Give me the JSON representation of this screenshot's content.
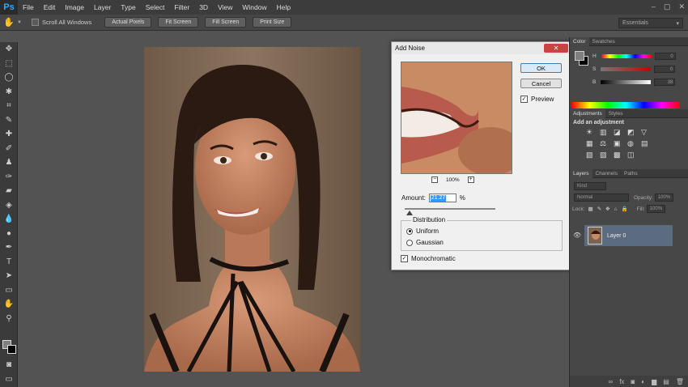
{
  "app": {
    "logo": "Ps"
  },
  "menu": [
    "File",
    "Edit",
    "Image",
    "Layer",
    "Type",
    "Select",
    "Filter",
    "3D",
    "View",
    "Window",
    "Help"
  ],
  "window_controls": [
    "–",
    "▢",
    "✕"
  ],
  "options": {
    "scroll_all": "Scroll All Windows",
    "buttons": [
      "Actual Pixels",
      "Fit Screen",
      "Fill Screen",
      "Print Size"
    ],
    "workspace": "Essentials"
  },
  "dialog": {
    "title": "Add Noise",
    "ok": "OK",
    "cancel": "Cancel",
    "preview_label": "Preview",
    "preview_checked": true,
    "zoom": "100%",
    "amount_label": "Amount:",
    "amount_value": "21.27",
    "amount_unit": "%",
    "amount_slider_fraction": 0.05,
    "distribution_label": "Distribution",
    "distribution_options": [
      "Uniform",
      "Gaussian"
    ],
    "distribution_selected": "Uniform",
    "monochromatic_label": "Monochromatic",
    "monochromatic_checked": true
  },
  "color_panel": {
    "tabs": [
      "Color",
      "Swatches"
    ],
    "rows": [
      {
        "label": "H",
        "value": "0"
      },
      {
        "label": "S",
        "value": "0"
      },
      {
        "label": "B",
        "value": "38"
      }
    ]
  },
  "adjustments_panel": {
    "tabs": [
      "Adjustments",
      "Styles"
    ],
    "title": "Add an adjustment",
    "icons": [
      "☀",
      "▥",
      "◪",
      "◩",
      "▽",
      "▦",
      "⚖",
      "▣",
      "◍",
      "▤",
      "▧",
      "▨",
      "▩",
      "◫"
    ]
  },
  "layers_panel": {
    "tabs": [
      "Layers",
      "Channels",
      "Paths"
    ],
    "kind": "Kind",
    "blend_mode": "Normal",
    "opacity_label": "Opacity:",
    "opacity_value": "100%",
    "lock_label": "Lock:",
    "fill_label": "Fill:",
    "fill_value": "100%",
    "layer_name": "Layer 0",
    "footer_icons": [
      "∞",
      "fx",
      "◙",
      "◐",
      "▆",
      "▤",
      "🗑"
    ]
  },
  "colors": {
    "accent": "#31a8ff",
    "selected_layer": "#5b6b80"
  }
}
